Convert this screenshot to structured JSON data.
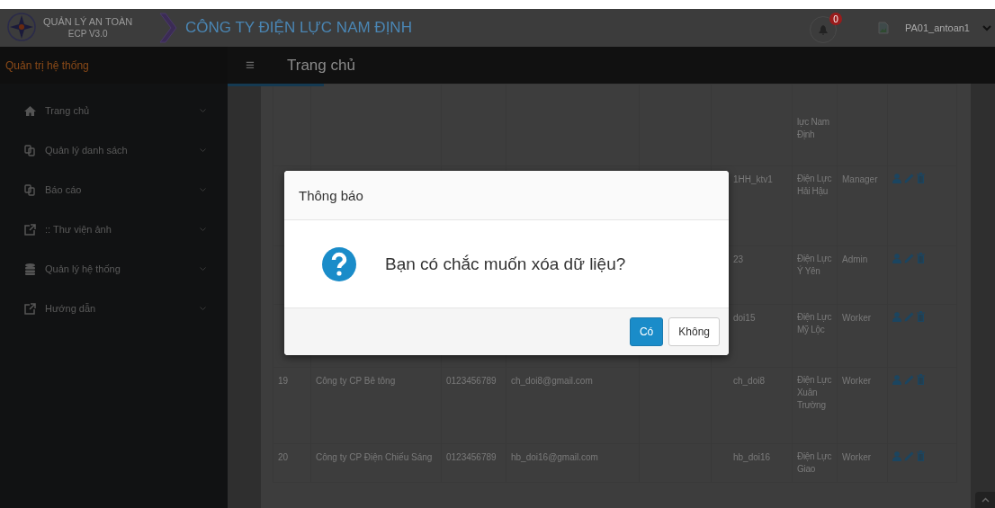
{
  "header": {
    "logo_title": "QUẢN LÝ AN TOÀN",
    "logo_subtitle": "ECP V3.0",
    "company": "CÔNG TY ĐIỆN LỰC NAM ĐỊNH",
    "notification_count": "0",
    "username": "PA01_antoan1"
  },
  "nav": {
    "sidebar_title": "Quản trị hệ thống",
    "menu_glyph": "≡",
    "page_title": "Trang chủ"
  },
  "sidebar": {
    "items": [
      {
        "label": "Trang chủ",
        "kind": "home"
      },
      {
        "label": "Quản lý danh sách",
        "kind": "copy"
      },
      {
        "label": "Báo cáo",
        "kind": "copy"
      },
      {
        "label": ":: Thư viện ảnh",
        "kind": "external"
      },
      {
        "label": "Quản lý hệ thống",
        "kind": "database"
      },
      {
        "label": "Hướng dẫn",
        "kind": "external"
      }
    ]
  },
  "table": {
    "rows": [
      {
        "column_7": "lực Nam Định",
        "actions": false
      },
      {
        "column_6": "1HH_ktv1",
        "column_7": "Điện Lực Hải Hậu",
        "column_8": "Manager",
        "actions": true
      },
      {
        "column_6": "23",
        "column_7": "Điện Lực Ý Yên",
        "column_8": "Admin",
        "actions": true
      },
      {
        "column_6": "doi15",
        "column_7": "Điện Lực Mỹ Lộc",
        "column_8": "Worker",
        "actions": true
      },
      {
        "column_1": "19",
        "column_2": "Công ty CP Bê tông",
        "column_3": "0123456789",
        "column_4": "ch_doi8@gmail.com",
        "column_6": "ch_doi8",
        "column_7": "Điện Lực Xuân Trường",
        "column_8": "Worker",
        "actions": true
      },
      {
        "column_1": "20",
        "column_2": "Công ty CP Điện Chiếu Sáng",
        "column_3": "0123456789",
        "column_4": "hb_doi16@gmail.com",
        "column_6": "hb_doi16",
        "column_7": "Điện Lực Giao",
        "column_8": "Worker",
        "actions": true
      }
    ]
  },
  "dialog": {
    "title": "Thông báo",
    "message": "Bạn có chắc muốn xóa dữ liệu?",
    "buttons": [
      {
        "label": "Có",
        "kind": "primary"
      },
      {
        "label": "Không",
        "kind": "default"
      }
    ]
  }
}
